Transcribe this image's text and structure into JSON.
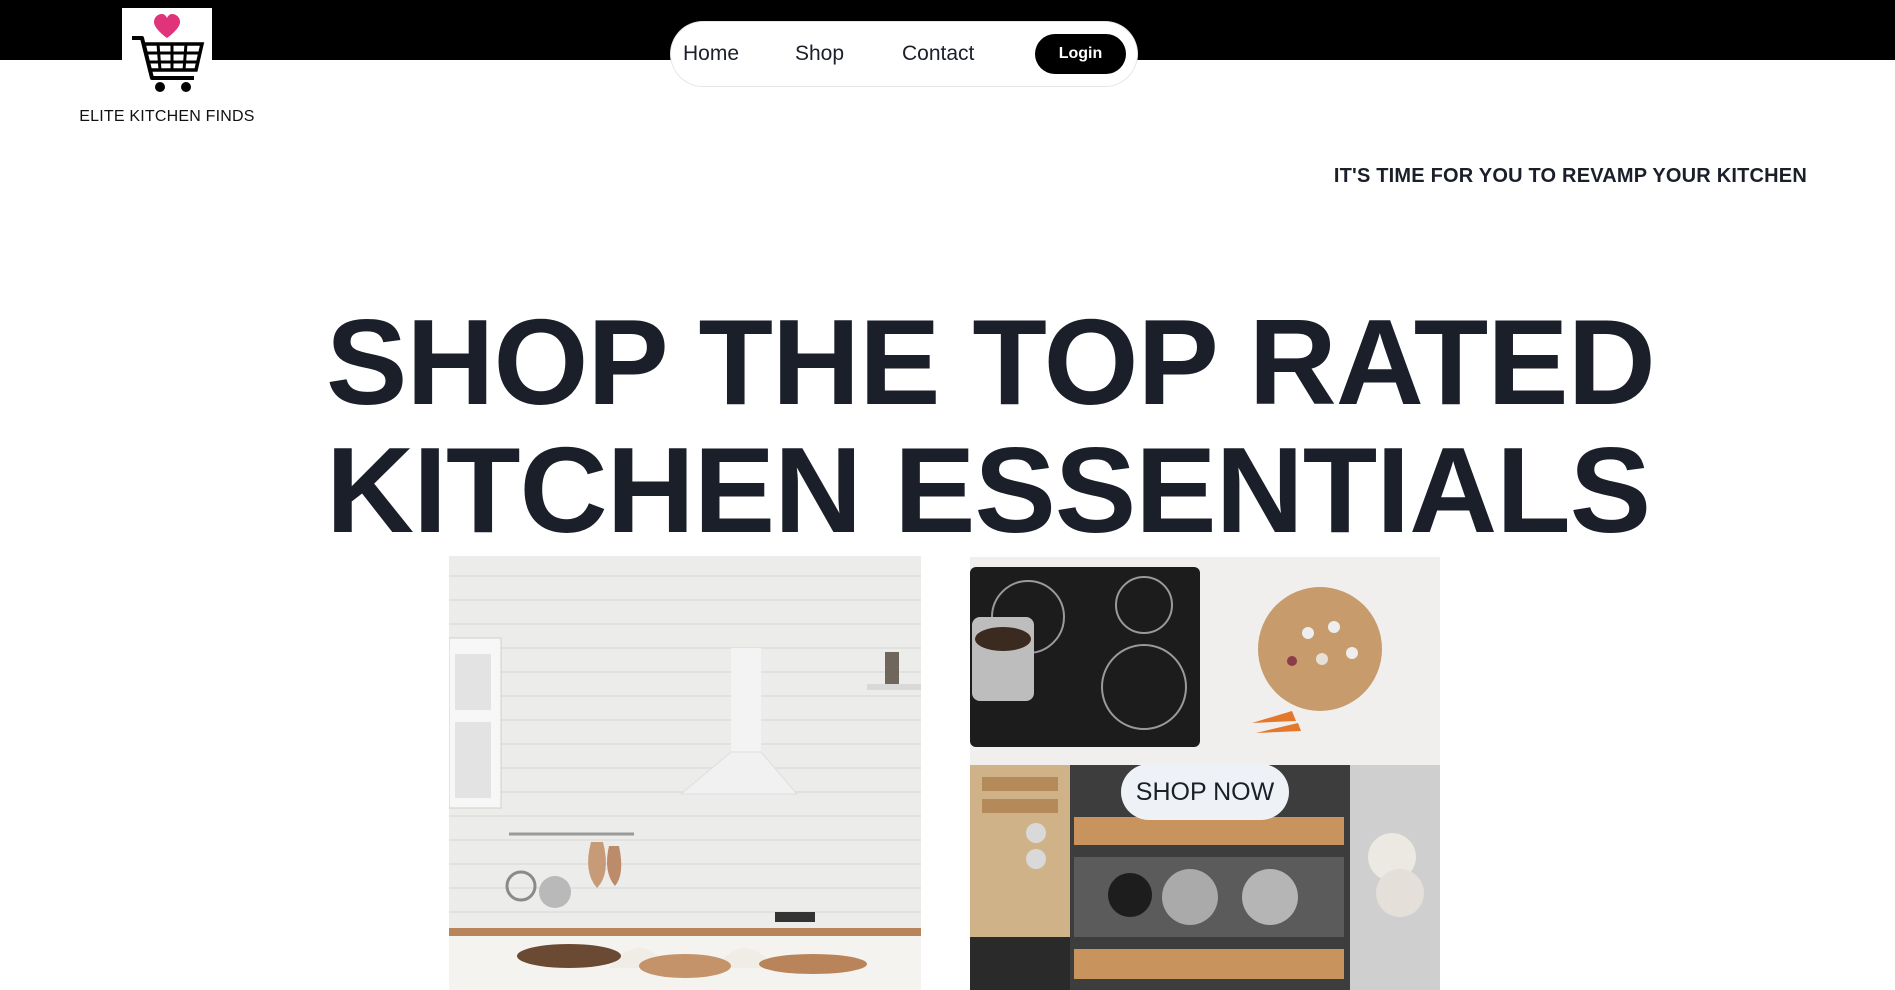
{
  "brand": {
    "name": "ELITE KITCHEN FINDS",
    "logo_icon": "shopping-cart-heart-icon",
    "heart_color": "#e0337a"
  },
  "nav": {
    "home": "Home",
    "shop": "Shop",
    "contact": "Contact",
    "login": "Login"
  },
  "tagline": "IT'S TIME FOR YOU TO REVAMP YOUR KITCHEN",
  "hero": {
    "line1": "SHOP THE TOP RATED",
    "line2": "KITCHEN ESSENTIALS"
  },
  "gallery": {
    "left_image": "white-brick-kitchen-photo",
    "right_image": "cooktop-and-drawers-photo",
    "cta": "SHOP NOW"
  },
  "colors": {
    "topbar": "#000000",
    "text": "#1b1f2a",
    "button_dark": "#000000",
    "button_light": "#eef1f6"
  }
}
